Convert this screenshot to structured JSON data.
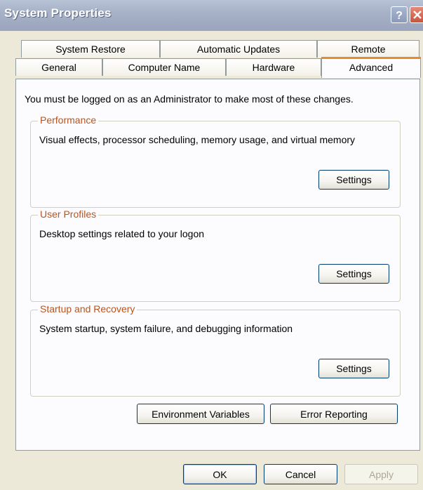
{
  "window": {
    "title": "System Properties"
  },
  "tabs": {
    "back_row": [
      "System Restore",
      "Automatic Updates",
      "Remote"
    ],
    "front_row": [
      "General",
      "Computer Name",
      "Hardware",
      "Advanced"
    ],
    "active": "Advanced"
  },
  "advanced": {
    "intro": "You must be logged on as an Administrator to make most of these changes.",
    "performance": {
      "legend": "Performance",
      "description": "Visual effects, processor scheduling, memory usage, and virtual memory",
      "button": "Settings"
    },
    "user_profiles": {
      "legend": "User Profiles",
      "description": "Desktop settings related to your logon",
      "button": "Settings"
    },
    "startup_recovery": {
      "legend": "Startup and Recovery",
      "description": "System startup, system failure, and debugging information",
      "button": "Settings"
    },
    "environment_variables_button": "Environment Variables",
    "error_reporting_button": "Error Reporting"
  },
  "footer": {
    "ok": "OK",
    "cancel": "Cancel",
    "apply": "Apply"
  },
  "colors": {
    "legend_text": "#b8541e",
    "active_tab_accent": "#e68b2c",
    "close_button": "#c9543c"
  },
  "icons": {
    "help": "question-mark",
    "close": "x-mark"
  }
}
